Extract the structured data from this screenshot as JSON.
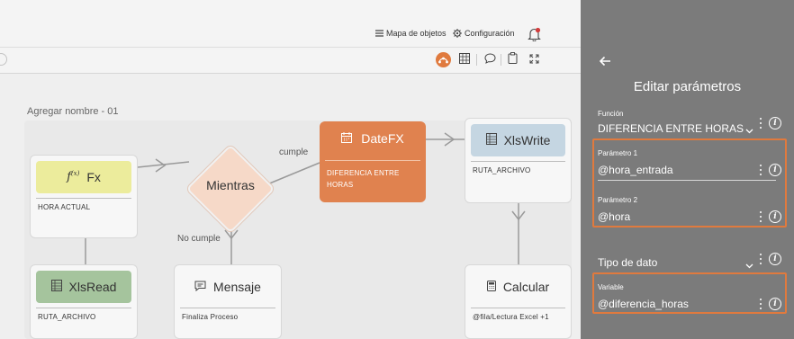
{
  "header": {
    "map_label": "Mapa de objetos",
    "config_label": "Configuración"
  },
  "canvas": {
    "flow_name_placeholder": "Agregar nombre - 01",
    "nodes": {
      "fx": {
        "title": "Fx",
        "text": "HORA ACTUAL"
      },
      "mientras": {
        "title": "Mientras"
      },
      "datefx": {
        "title": "DateFX",
        "text": "DIFERENCIA ENTRE\nHORAS"
      },
      "xlswrite": {
        "title": "XlsWrite",
        "text": "RUTA_ARCHIVO"
      },
      "xlsread": {
        "title": "XlsRead",
        "text": "RUTA_ARCHIVO"
      },
      "mensaje": {
        "title": "Mensaje",
        "text": "Finaliza Proceso"
      },
      "calcular": {
        "title": "Calcular",
        "text": "@fila/Lectura Excel +1"
      }
    },
    "edge_labels": {
      "yes": "cumple",
      "no": "No cumple"
    }
  },
  "panel": {
    "title": "Editar parámetros",
    "funcion_label": "Función",
    "funcion_value": "DIFERENCIA ENTRE HORAS",
    "param1_label": "Parámetro 1",
    "param1_value": "@hora_entrada",
    "param2_label": "Parámetro 2",
    "param2_value": "@hora",
    "tipo_label": "Tipo de dato",
    "variable_label": "Variable",
    "variable_value": "@diferencia_horas"
  },
  "colors": {
    "panel_bg": "#7b7b7b",
    "highlight": "#e07a3e",
    "fx_head": "#ecec9c",
    "datefx_node": "#e0824f",
    "xlswrite_head": "#c5d6e2",
    "xlsread_head": "#a5c49d",
    "mientras_fill": "#f6d9c8"
  }
}
